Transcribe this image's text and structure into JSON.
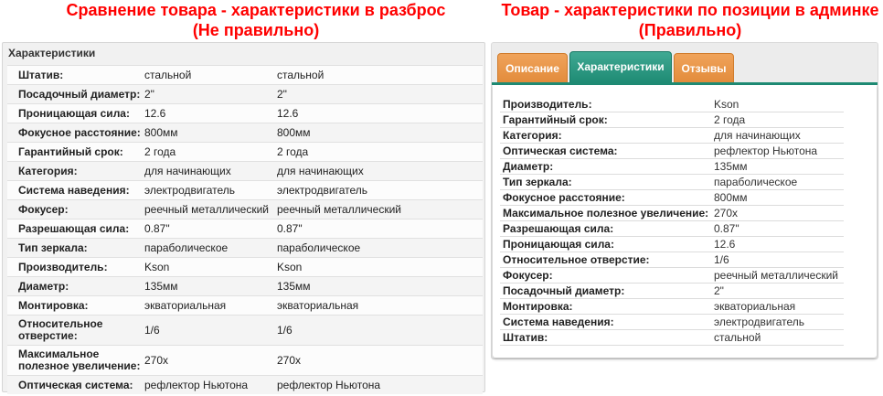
{
  "left_title_line1": "Сравнение товара - характеристики в разброс",
  "left_title_line2": "(Не правильно)",
  "right_title_line1": "Товар - характеристики по позиции в админке",
  "right_title_line2": "(Правильно)",
  "compare": {
    "header": "Характеристики",
    "rows": [
      {
        "label": "Штатив:",
        "v1": "стальной",
        "v2": "стальной"
      },
      {
        "label": "Посадочный диаметр:",
        "v1": "2\"",
        "v2": "2\""
      },
      {
        "label": "Проницающая сила:",
        "v1": "12.6",
        "v2": "12.6"
      },
      {
        "label": "Фокусное расстояние:",
        "v1": "800мм",
        "v2": "800мм"
      },
      {
        "label": "Гарантийный срок:",
        "v1": "2 года",
        "v2": "2 года"
      },
      {
        "label": "Категория:",
        "v1": "для начинающих",
        "v2": "для начинающих"
      },
      {
        "label": "Система наведения:",
        "v1": "электродвигатель",
        "v2": "электродвигатель"
      },
      {
        "label": "Фокусер:",
        "v1": "реечный металлический",
        "v2": "реечный металлический"
      },
      {
        "label": "Разрешающая сила:",
        "v1": "0.87\"",
        "v2": "0.87\""
      },
      {
        "label": "Тип зеркала:",
        "v1": "параболическое",
        "v2": "параболическое"
      },
      {
        "label": "Производитель:",
        "v1": "Kson",
        "v2": "Kson"
      },
      {
        "label": "Диаметр:",
        "v1": "135мм",
        "v2": "135мм"
      },
      {
        "label": "Монтировка:",
        "v1": "экваториальная",
        "v2": "экваториальная"
      },
      {
        "label": "Относительное отверстие:",
        "v1": "1/6",
        "v2": "1/6"
      },
      {
        "label": "Максимальное полезное увеличение:",
        "v1": "270x",
        "v2": "270x"
      },
      {
        "label": "Оптическая система:",
        "v1": "рефлектор Ньютона",
        "v2": "рефлектор Ньютона"
      }
    ]
  },
  "tabs": [
    {
      "label": "Описание",
      "active": false
    },
    {
      "label": "Характеристики",
      "active": true
    },
    {
      "label": "Отзывы",
      "active": false
    }
  ],
  "specs": [
    {
      "label": "Производитель:",
      "value": "Kson"
    },
    {
      "label": "Гарантийный срок:",
      "value": "2 года"
    },
    {
      "label": "Категория:",
      "value": "для начинающих"
    },
    {
      "label": "Оптическая система:",
      "value": "рефлектор Ньютона"
    },
    {
      "label": "Диаметр:",
      "value": "135мм"
    },
    {
      "label": "Тип зеркала:",
      "value": "параболическое"
    },
    {
      "label": "Фокусное расстояние:",
      "value": "800мм"
    },
    {
      "label": "Максимальное полезное увеличение:",
      "value": "270x"
    },
    {
      "label": "Разрешающая сила:",
      "value": "0.87\""
    },
    {
      "label": "Проницающая сила:",
      "value": "12.6"
    },
    {
      "label": "Относительное отверстие:",
      "value": "1/6"
    },
    {
      "label": "Фокусер:",
      "value": "реечный металлический"
    },
    {
      "label": "Посадочный диаметр:",
      "value": "2\""
    },
    {
      "label": "Монтировка:",
      "value": "экваториальная"
    },
    {
      "label": "Система наведения:",
      "value": "электродвигатель"
    },
    {
      "label": "Штатив:",
      "value": "стальной"
    }
  ],
  "colors": {
    "title_red": "#ff0000",
    "tab_orange": "#e28b3b",
    "tab_green": "#1e8a73"
  }
}
